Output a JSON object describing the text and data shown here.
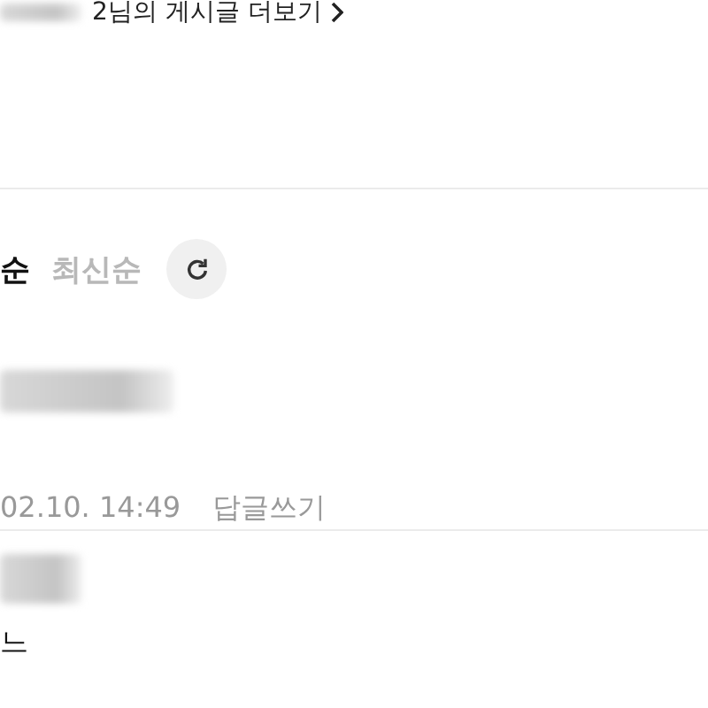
{
  "more_link": {
    "text": "2님의 게시글 더보기",
    "author_redacted": true
  },
  "sort_options": [
    {
      "label": "순",
      "selected": true
    },
    {
      "label": "최신순",
      "selected": false
    }
  ],
  "comments": [
    {
      "author_redacted": true,
      "date": "02.10. 14:49",
      "reply": "답글쓰기"
    },
    {
      "author_redacted": true,
      "text": "느"
    }
  ]
}
